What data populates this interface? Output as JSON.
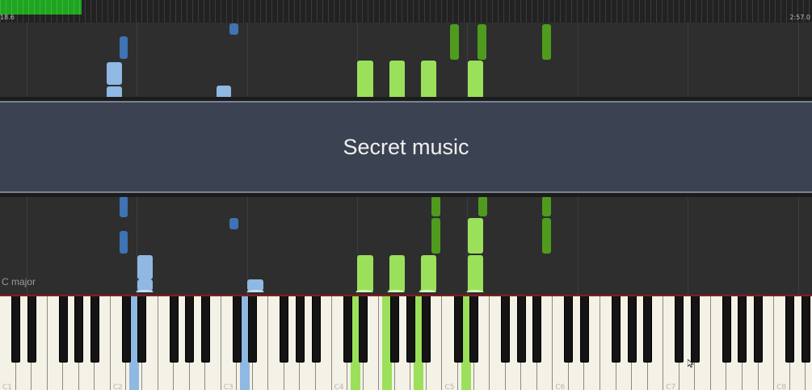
{
  "timeline": {
    "elapsed": "18.6",
    "total": "2:57.0",
    "progress": 0.1
  },
  "banner": {
    "title": "Secret music"
  },
  "key_signature": "C major",
  "keyboard": {
    "octave_labels": [
      "C1",
      "C2",
      "C3",
      "C4",
      "C5",
      "C6",
      "C7",
      "C8"
    ]
  },
  "colors": {
    "left_hand_light": "#8fb8e3",
    "left_hand_dark": "#3e73b4",
    "right_hand_light": "#9be05a",
    "right_hand_dark": "#4f9b1e",
    "progress": "#1fa51f"
  }
}
